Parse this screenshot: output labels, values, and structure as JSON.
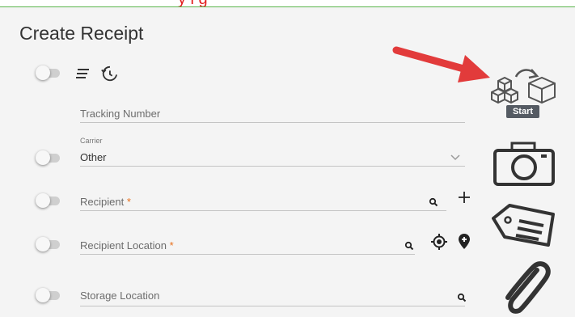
{
  "banner": {
    "text": "y i   g"
  },
  "page": {
    "title": "Create Receipt"
  },
  "fields": {
    "tracking": {
      "label": "Tracking Number"
    },
    "carrier": {
      "label": "Carrier",
      "value": "Other"
    },
    "recipient": {
      "label": "Recipient",
      "required_mark": "*"
    },
    "recipient_location": {
      "label": "Recipient Location",
      "required_mark": "*"
    },
    "storage_location": {
      "label": "Storage Location"
    }
  },
  "actions": {
    "start_label": "Start"
  },
  "colors": {
    "annotation_arrow": "#e23b3b",
    "required": "#e8711d",
    "accent_line": "#59b44a"
  }
}
